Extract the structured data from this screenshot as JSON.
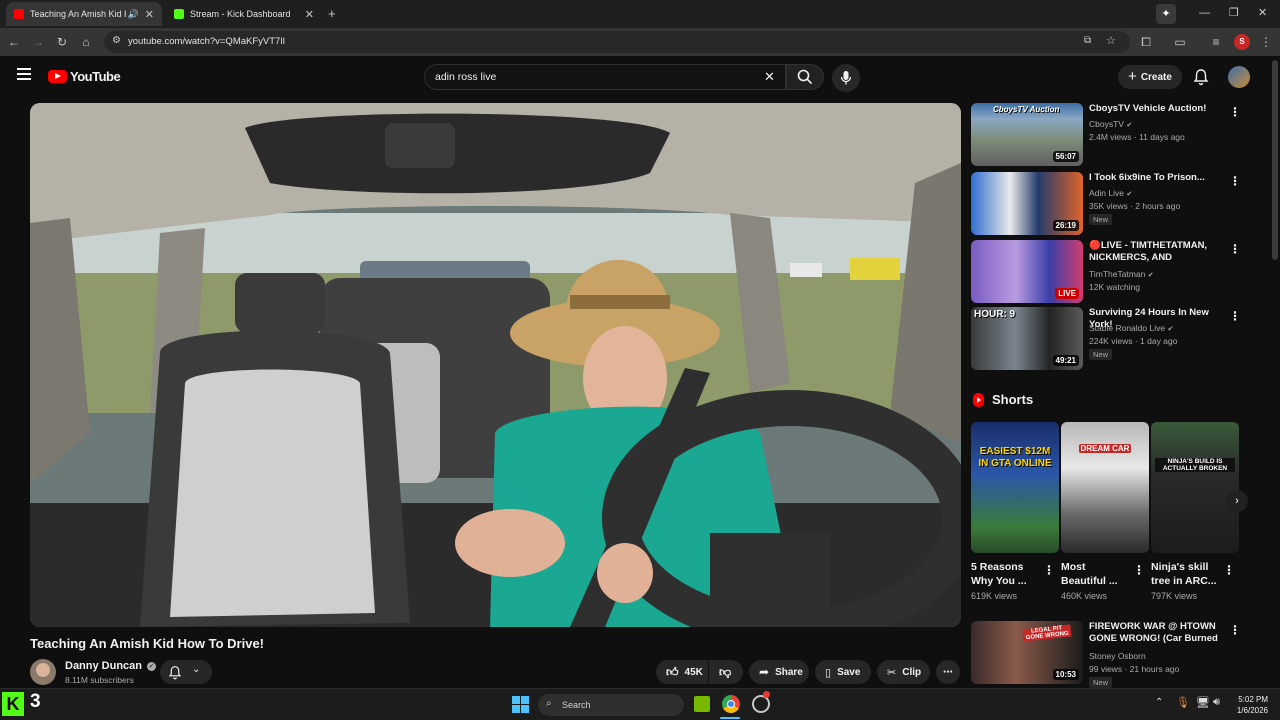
{
  "browser": {
    "tabs": [
      {
        "title": "Teaching An Amish Kid How",
        "active": true,
        "favicon_color": "#ff0000"
      },
      {
        "title": "Stream - Kick Dashboard",
        "active": false,
        "favicon_color": "#53fc18"
      }
    ],
    "url": "youtube.com/watch?v=QMaKFyVT7lI",
    "profile_initial": "S"
  },
  "youtube": {
    "logo_text": "YouTube",
    "search_value": "adin ross live",
    "create_label": "Create"
  },
  "video": {
    "title": "Teaching An Amish Kid How To Drive!",
    "channel": "Danny Duncan",
    "subscribers": "8.11M subscribers",
    "likes": "45K",
    "share_label": "Share",
    "save_label": "Save",
    "clip_label": "Clip"
  },
  "recommendations": [
    {
      "title": "CboysTV Vehicle Auction!",
      "channel": "CboysTV",
      "meta": "2.4M views · 11 days ago",
      "duration": "56:07",
      "badge": "",
      "thumb_text": "CboysTV Auction"
    },
    {
      "title": "I Took 6ix9ine To Prison...",
      "channel": "Adin Live",
      "meta": "35K views · 2 hours ago",
      "duration": "26:19",
      "badge": "New",
      "thumb_text": ""
    },
    {
      "title": "🔴LIVE - TIMTHETATMAN, NICKMERCS, AND HUTCHMF ...",
      "channel": "TimTheTatman",
      "meta": "12K watching",
      "duration": "LIVE",
      "badge": "",
      "thumb_text": ""
    },
    {
      "title": "Surviving 24 Hours In New York!",
      "channel": "Stable Ronaldo Live",
      "meta": "224K views · 1 day ago",
      "duration": "49:21",
      "badge": "New",
      "thumb_text": "HOUR: 9"
    },
    {
      "title": "FIREWORK WAR @ HTOWN GONE WRONG! (Car Burned ...",
      "channel": "Stoney Osborn",
      "meta": "99 views · 21 hours ago",
      "duration": "10:53",
      "badge": "New",
      "thumb_text": "LEGAL PIT GONE WRONG"
    }
  ],
  "shorts": {
    "heading": "Shorts",
    "items": [
      {
        "title": "5 Reasons Why You ...",
        "views": "619K views",
        "thumb_text": "EASIEST $12M IN GTA ONLINE"
      },
      {
        "title": "Most Beautiful ...",
        "views": "460K views",
        "thumb_text": "DREAM CAR"
      },
      {
        "title": "Ninja's skill tree in ARC...",
        "views": "797K views",
        "thumb_text": "NINJA'S BUILD IS ACTUALLY BROKEN"
      }
    ]
  },
  "taskbar": {
    "kick_badge": "3",
    "search_placeholder": "Search",
    "time": "5:02 PM",
    "date": "1/6/2026"
  }
}
